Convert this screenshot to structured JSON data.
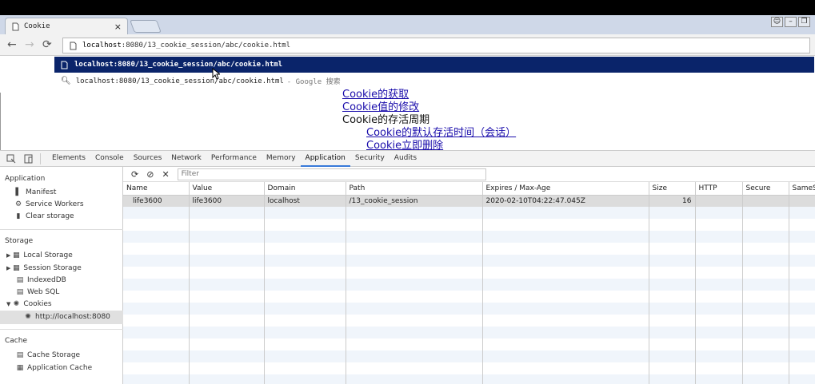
{
  "browser": {
    "tab_title": "Cookie",
    "tab_close": "×",
    "url_host": "localhost",
    "url_rest": ":8080/13_cookie_session/abc/cookie.html",
    "suggestions": [
      {
        "text": "localhost:8080/13_cookie_session/abc/cookie.html"
      },
      {
        "text": "localhost:8080/13_cookie_session/abc/cookie.html",
        "suffix": "- Google 搜索"
      }
    ]
  },
  "page": {
    "links": [
      {
        "text": "Cookie的获取"
      },
      {
        "text": "Cookie值的修改"
      },
      {
        "text": "Cookie的存活周期"
      },
      {
        "text": "Cookie的默认存活时间（会话）"
      },
      {
        "text": "Cookie立即删除"
      }
    ]
  },
  "devtools": {
    "tabs": [
      "Elements",
      "Console",
      "Sources",
      "Network",
      "Performance",
      "Memory",
      "Application",
      "Security",
      "Audits"
    ],
    "active_tab": "Application",
    "sidebar": {
      "application_header": "Application",
      "application_items": [
        "Manifest",
        "Service Workers",
        "Clear storage"
      ],
      "storage_header": "Storage",
      "storage_items": [
        "Local Storage",
        "Session Storage",
        "IndexedDB",
        "Web SQL",
        "Cookies"
      ],
      "cookie_origin": "http://localhost:8080",
      "cache_header": "Cache",
      "cache_items": [
        "Cache Storage",
        "Application Cache"
      ]
    },
    "filter_placeholder": "Filter",
    "columns": [
      "Name",
      "Value",
      "Domain",
      "Path",
      "Expires / Max-Age",
      "Size",
      "HTTP",
      "Secure",
      "SameSite"
    ],
    "rows": [
      {
        "name": "life3600",
        "value": "life3600",
        "domain": "localhost",
        "path": "/13_cookie_session",
        "expires": "2020-02-10T04:22:47.045Z",
        "size": "16",
        "http": "",
        "secure": "",
        "samesite": ""
      }
    ]
  }
}
